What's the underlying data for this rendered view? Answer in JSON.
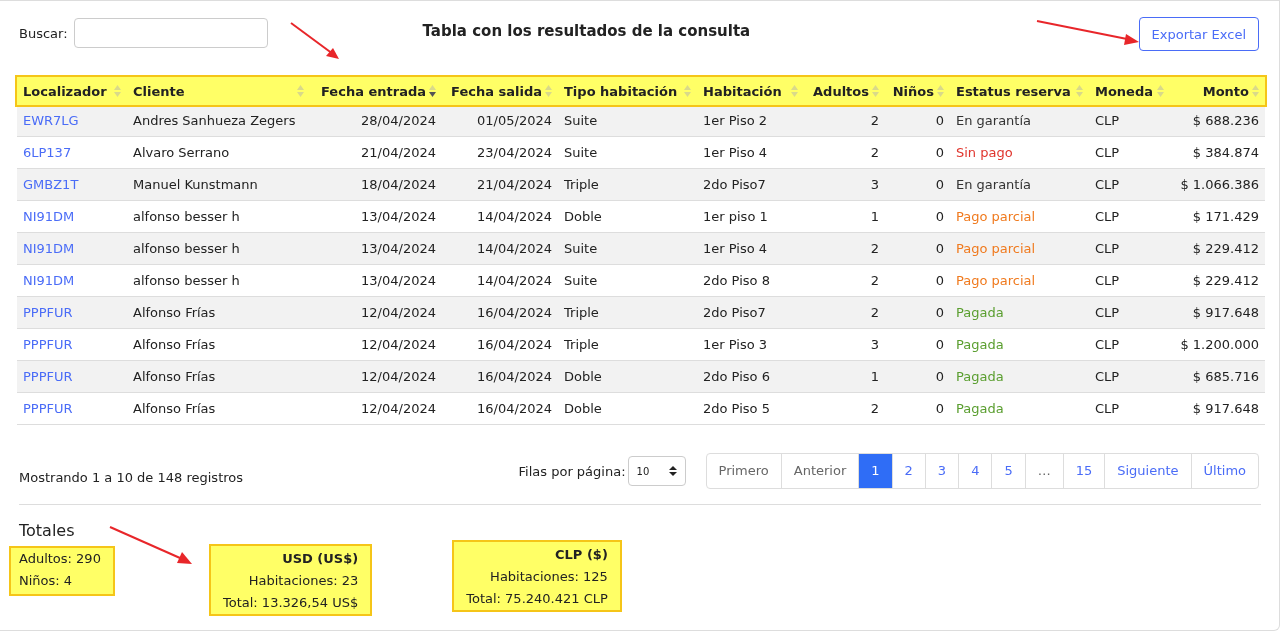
{
  "search": {
    "label": "Buscar:"
  },
  "title": "Tabla con los resultados de la consulta",
  "export_button": "Exportar Excel",
  "table": {
    "columns": [
      {
        "label": "Localizador",
        "kind": "text",
        "sorted": false
      },
      {
        "label": "Cliente",
        "kind": "text",
        "sorted": false
      },
      {
        "label": "Fecha entrada",
        "kind": "number",
        "sorted": true
      },
      {
        "label": "Fecha salida",
        "kind": "number",
        "sorted": false
      },
      {
        "label": "Tipo habitación",
        "kind": "text",
        "sorted": false
      },
      {
        "label": "Habitación",
        "kind": "text",
        "sorted": false
      },
      {
        "label": "Adultos",
        "kind": "number",
        "sorted": false
      },
      {
        "label": "Niños",
        "kind": "number",
        "sorted": false
      },
      {
        "label": "Estatus reserva",
        "kind": "text",
        "sorted": false
      },
      {
        "label": "Moneda",
        "kind": "text",
        "sorted": false
      },
      {
        "label": "Monto",
        "kind": "number",
        "sorted": false
      }
    ],
    "rows": [
      {
        "cells": [
          "EWR7LG",
          "Andres Sanhueza Zegers",
          "28/04/2024",
          "01/05/2024",
          "Suite",
          "1er Piso 2",
          "2",
          "0",
          "En garantía",
          "CLP",
          "$ 688.236"
        ],
        "color": "#333333"
      },
      {
        "cells": [
          "6LP137",
          "Alvaro Serrano",
          "21/04/2024",
          "23/04/2024",
          "Suite",
          "1er Piso 4",
          "2",
          "0",
          "Sin pago",
          "CLP",
          "$ 384.874"
        ],
        "color": "#e0342c"
      },
      {
        "cells": [
          "GMBZ1T",
          "Manuel Kunstmann",
          "18/04/2024",
          "21/04/2024",
          "Triple",
          "2do Piso7",
          "3",
          "0",
          "En garantía",
          "CLP",
          "$ 1.066.386"
        ],
        "color": "#333333"
      },
      {
        "cells": [
          "NI91DM",
          "alfonso besser h",
          "13/04/2024",
          "14/04/2024",
          "Doble",
          "1er piso 1",
          "1",
          "0",
          "Pago parcial",
          "CLP",
          "$ 171.429"
        ],
        "color": "#f07a1e"
      },
      {
        "cells": [
          "NI91DM",
          "alfonso besser h",
          "13/04/2024",
          "14/04/2024",
          "Suite",
          "1er Piso 4",
          "2",
          "0",
          "Pago parcial",
          "CLP",
          "$ 229.412"
        ],
        "color": "#f07a1e"
      },
      {
        "cells": [
          "NI91DM",
          "alfonso besser h",
          "13/04/2024",
          "14/04/2024",
          "Suite",
          "2do Piso 8",
          "2",
          "0",
          "Pago parcial",
          "CLP",
          "$ 229.412"
        ],
        "color": "#f07a1e"
      },
      {
        "cells": [
          "PPPFUR",
          "Alfonso Frías",
          "12/04/2024",
          "16/04/2024",
          "Triple",
          "2do Piso7",
          "2",
          "0",
          "Pagada",
          "CLP",
          "$ 917.648"
        ],
        "color": "#5a9e2f"
      },
      {
        "cells": [
          "PPPFUR",
          "Alfonso Frías",
          "12/04/2024",
          "16/04/2024",
          "Triple",
          "1er Piso 3",
          "3",
          "0",
          "Pagada",
          "CLP",
          "$ 1.200.000"
        ],
        "color": "#5a9e2f"
      },
      {
        "cells": [
          "PPPFUR",
          "Alfonso Frías",
          "12/04/2024",
          "16/04/2024",
          "Doble",
          "2do Piso 6",
          "1",
          "0",
          "Pagada",
          "CLP",
          "$ 685.716"
        ],
        "color": "#5a9e2f"
      },
      {
        "cells": [
          "PPPFUR",
          "Alfonso Frías",
          "12/04/2024",
          "16/04/2024",
          "Doble",
          "2do Piso 5",
          "2",
          "0",
          "Pagada",
          "CLP",
          "$ 917.648"
        ],
        "color": "#5a9e2f"
      }
    ]
  },
  "info": "Mostrando 1 a 10 de 148 registros",
  "page_size": {
    "label": "Filas por página:",
    "value": "10"
  },
  "pagination": [
    {
      "label": "Primero",
      "selected": false,
      "disabled": true
    },
    {
      "label": "Anterior",
      "selected": false,
      "disabled": true
    },
    {
      "label": "1",
      "selected": true,
      "disabled": false
    },
    {
      "label": "2",
      "selected": false,
      "disabled": false
    },
    {
      "label": "3",
      "selected": false,
      "disabled": false
    },
    {
      "label": "4",
      "selected": false,
      "disabled": false
    },
    {
      "label": "5",
      "selected": false,
      "disabled": false
    },
    {
      "label": "…",
      "selected": false,
      "disabled": true
    },
    {
      "label": "15",
      "selected": false,
      "disabled": false
    },
    {
      "label": "Siguiente",
      "selected": false,
      "disabled": false
    },
    {
      "label": "Último",
      "selected": false,
      "disabled": false
    }
  ],
  "totals": {
    "heading": "Totales",
    "people": [
      "Adultos: 290",
      "Niños: 4"
    ],
    "currencies": [
      {
        "title": "USD (US$)",
        "lines": [
          "Habitaciones: 23",
          "Total: 13.326,54 US$"
        ]
      },
      {
        "title": "CLP ($)",
        "lines": [
          "Habitaciones: 125",
          "Total: 75.240.421 CLP"
        ]
      }
    ]
  }
}
